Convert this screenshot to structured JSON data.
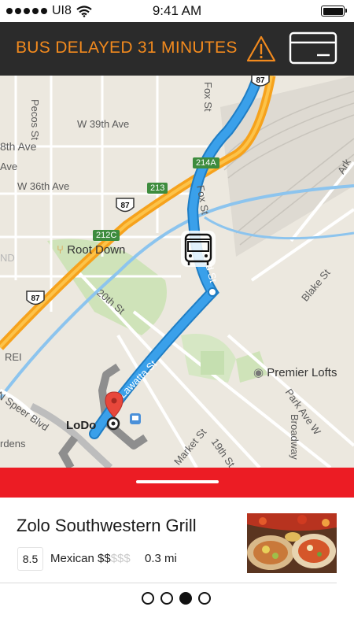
{
  "status_bar": {
    "carrier": "UI8",
    "time": "9:41 AM"
  },
  "alert": {
    "message": "BUS DELAYED 31 MINUTES",
    "color": "#f28a1e",
    "icons": [
      "warning-icon",
      "card-icon"
    ]
  },
  "map": {
    "labels": {
      "pecos_st": "Pecos St",
      "w39": "W 39th Ave",
      "ave38": "8th Ave",
      "ave": "Ave",
      "w36": "W 36th Ave",
      "root_down": "Root Down",
      "nd": "ND",
      "fox_st_top": "Fox St",
      "fox_st": "Fox St",
      "st23": "23rd St",
      "st20": "20th St",
      "blake": "Blake St",
      "premier": "Premier Lofts",
      "park": "Park Ave W",
      "broadway": "Broadway",
      "market": "Market St",
      "st19": "19th St",
      "rei": "REI",
      "speer": "N Speer Blvd",
      "lodo": "LoDo",
      "gardens": "rdens",
      "lawatta": "Lawatta St",
      "ark": "Ark"
    },
    "shields": {
      "r87a": "87",
      "r87b": "87",
      "r87c": "87",
      "r213": "213",
      "r214a": "214A",
      "r212c": "212C"
    },
    "route_color": "#3aa0ea",
    "bus_icon": "bus-icon",
    "pin_icon": "map-pin-icon"
  },
  "place": {
    "name": "Zolo Southwestern Grill",
    "rating": "8.5",
    "cuisine": "Mexican",
    "price": "$$",
    "price_dim": "$$$",
    "distance": "0.3 mi",
    "image": "food-photo"
  },
  "pager": {
    "count": 4,
    "active_index": 2
  },
  "colors": {
    "alert_bg": "#2b2b2b",
    "sheet_bar": "#ec1c24"
  }
}
